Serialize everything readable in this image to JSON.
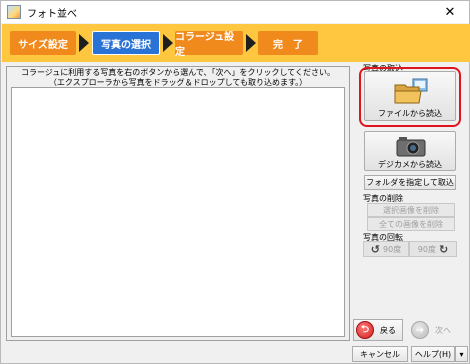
{
  "window": {
    "title": "フォト並べ",
    "close_glyph": "✕"
  },
  "steps": [
    {
      "label": "サイズ設定",
      "state": "done"
    },
    {
      "label": "写真の選択",
      "state": "active"
    },
    {
      "label": "コラージュ設定",
      "state": "pending"
    },
    {
      "label": "完　了",
      "state": "pending"
    }
  ],
  "main": {
    "instruction_line1": "コラージュに利用する写真を右のボタンから選んで、「次へ」をクリックしてください。",
    "instruction_line2": "（エクスプローラから写真をドラッグ＆ドロップしても取り込めます。）"
  },
  "sidebar": {
    "import_group": "写真の取込",
    "from_file": "ファイルから読込",
    "from_camera": "デジカメから読込",
    "from_folder": "フォルダを指定して取込",
    "delete_group": "写真の削除",
    "delete_selected": "選択画像を削除",
    "delete_all": "全ての画像を削除",
    "rotate_group": "写真の回転",
    "rotate_left": "90度",
    "rotate_right": "90度"
  },
  "nav": {
    "back": "戻る",
    "next": "次へ"
  },
  "footer": {
    "cancel": "キャンセル",
    "help": "ヘルプ(H)"
  },
  "colors": {
    "step_orange": "#f08a1c",
    "step_active": "#2a73d6",
    "step_bar": "#ffc640",
    "highlight": "#e0141c"
  }
}
